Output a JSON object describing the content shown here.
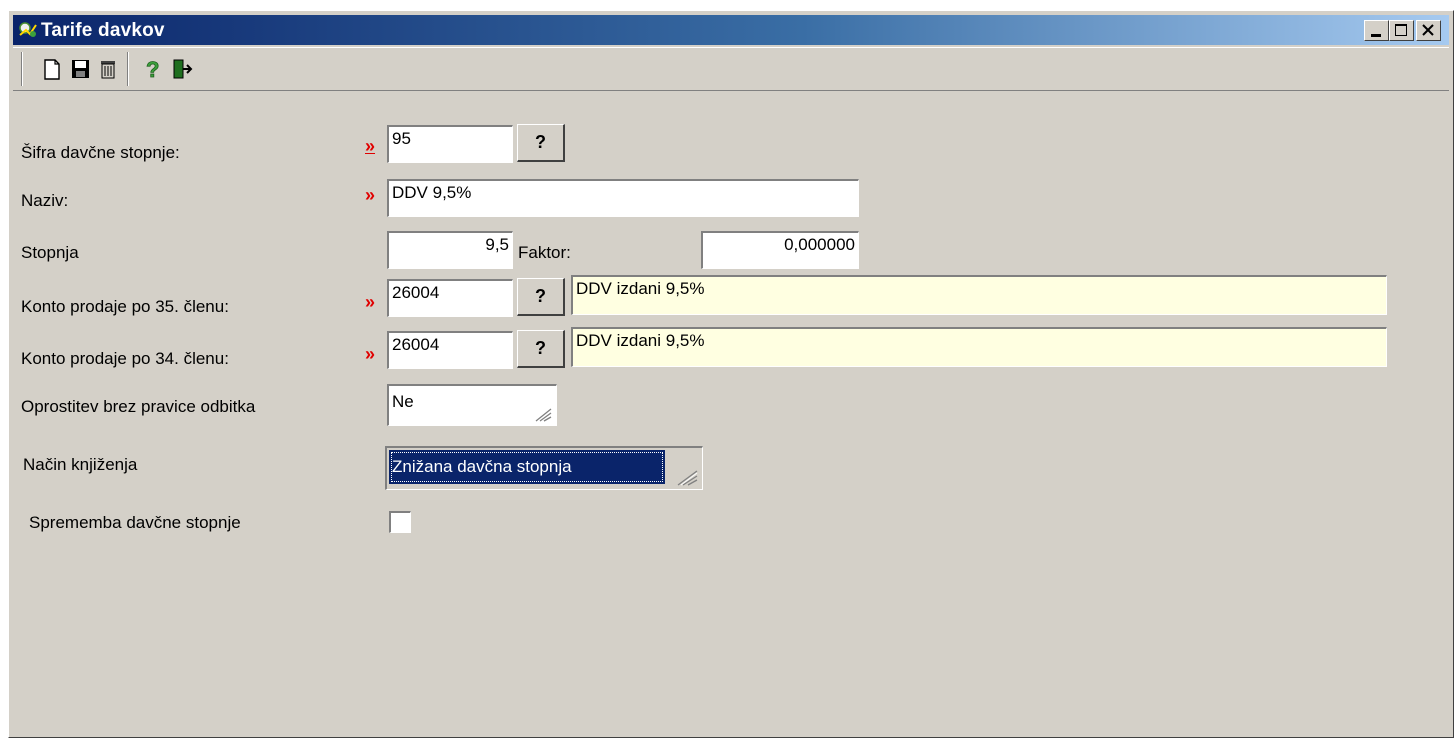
{
  "window": {
    "title": "Tarife davkov",
    "controls": [
      "minimize-icon",
      "maximize-icon",
      "close-icon"
    ]
  },
  "toolbar": {
    "buttons": [
      {
        "name": "new",
        "icon": "new-document-icon"
      },
      {
        "name": "save",
        "icon": "save-disk-icon"
      },
      {
        "name": "delete",
        "icon": "delete-trash-icon"
      },
      {
        "name": "help",
        "icon": "help-question-icon"
      },
      {
        "name": "exit",
        "icon": "exit-door-icon"
      }
    ]
  },
  "form": {
    "sifra": {
      "label": "Šifra davčne stopnje:",
      "value": "95",
      "lookup": "?"
    },
    "naziv": {
      "label": "Naziv:",
      "value": "DDV 9,5%"
    },
    "stopnja": {
      "label": "Stopnja",
      "value": "9,5",
      "faktor_label": "Faktor:",
      "faktor_value": "0,000000"
    },
    "konto35": {
      "label": "Konto prodaje po 35. členu:",
      "value": "26004",
      "lookup": "?",
      "description": "DDV izdani 9,5%"
    },
    "konto34": {
      "label": "Konto prodaje po 34. členu:",
      "value": "26004",
      "lookup": "?",
      "description": "DDV izdani 9,5%"
    },
    "oprostitev": {
      "label": "Oprostitev brez pravice odbitka",
      "value": "Ne"
    },
    "nacin": {
      "label": "Način knjiženja",
      "value": "Znižana davčna stopnja"
    },
    "sprememba": {
      "label": "Sprememba davčne stopnje",
      "checked": false
    }
  },
  "colors": {
    "required_marker": "#e00000",
    "title_gradient_start": "#0a246a",
    "title_gradient_end": "#a6caf0",
    "description_bg": "#ffffe1",
    "selection_bg": "#0a246a"
  },
  "required_marker": "»"
}
